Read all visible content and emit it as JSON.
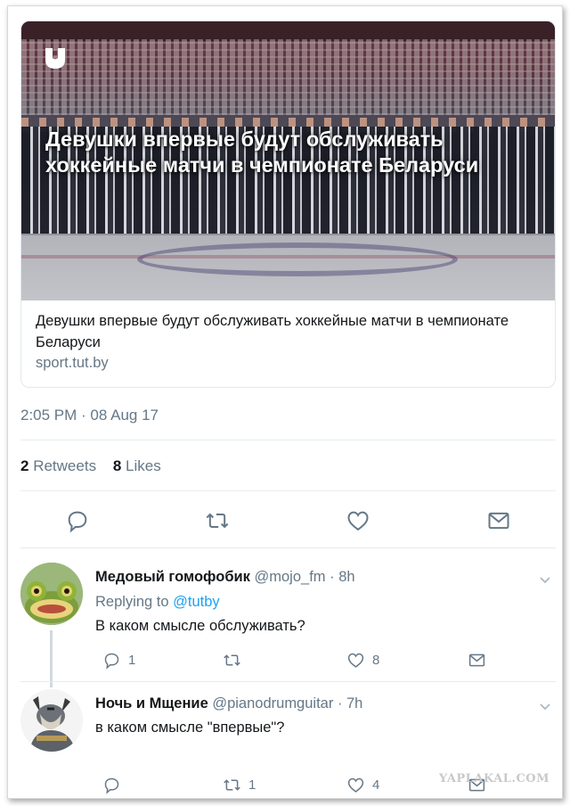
{
  "card": {
    "headline": "Девушки впервые будут обслуживать хоккейные матчи в чемпионате Беларуси",
    "text": "Девушки впервые будут обслуживать хоккейные матчи в чемпионате Беларуси",
    "domain": "sport.tut.by",
    "logo_icon": "tutby-logo-icon"
  },
  "tweet": {
    "timestamp": "2:05 PM · 08 Aug 17",
    "retweets_count": "2",
    "retweets_label": "Retweets",
    "likes_count": "8",
    "likes_label": "Likes"
  },
  "actions": {
    "reply_icon": "reply-icon",
    "retweet_icon": "retweet-icon",
    "like_icon": "heart-icon",
    "message_icon": "mail-icon"
  },
  "replies": [
    {
      "name": "Медовый гомофобик",
      "handle": "@mojo_fm · 8h",
      "replying_to": "Replying to",
      "mention": "@tutby",
      "text": "В каком смысле обслуживать?",
      "reply_count": "1",
      "retweet_count": "",
      "like_count": "8"
    },
    {
      "name": "Ночь и Мщение",
      "handle": "@pianodrumguitar · 7h",
      "text": "в каком смысле \"впервые\"?",
      "reply_count": "",
      "retweet_count": "1",
      "like_count": "4"
    }
  ],
  "watermark": "YAPLAKAL.COM",
  "colors": {
    "accent": "#1da1f2",
    "secondary_text": "#657786",
    "icon": "#657786"
  }
}
